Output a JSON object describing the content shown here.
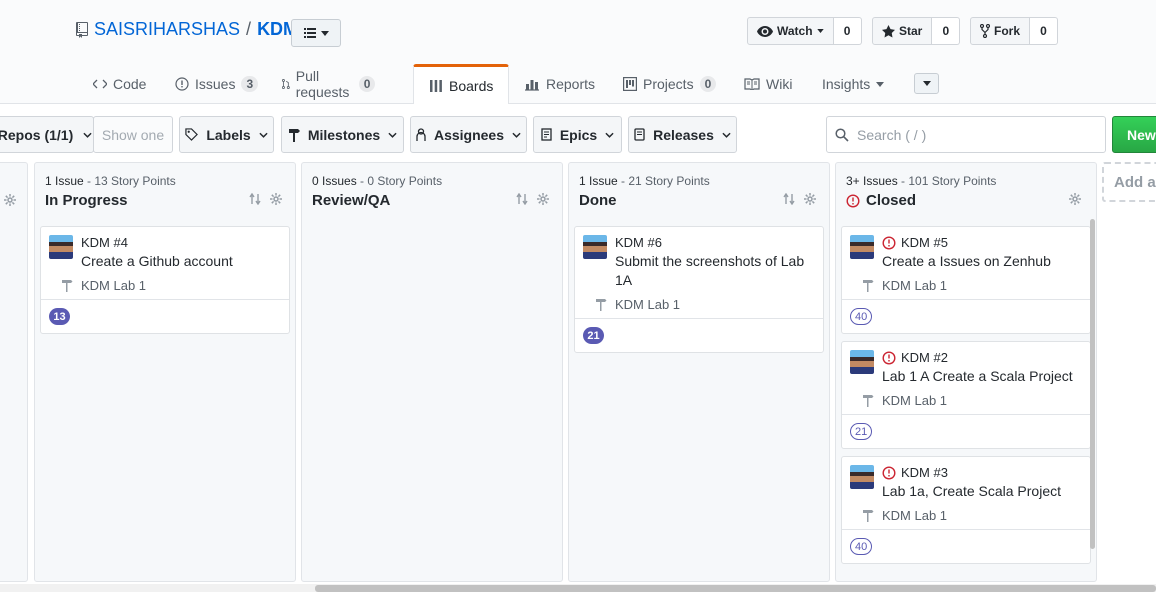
{
  "repo": {
    "owner": "SAISRIHARSHAS",
    "separator": "/",
    "name": "KDM"
  },
  "actions": {
    "watch": {
      "label": "Watch",
      "count": "0"
    },
    "star": {
      "label": "Star",
      "count": "0"
    },
    "fork": {
      "label": "Fork",
      "count": "0"
    }
  },
  "tabs": [
    {
      "label": "Code",
      "icon": "code-icon"
    },
    {
      "label": "Issues",
      "count": "3",
      "icon": "issue-icon"
    },
    {
      "label": "Pull requests",
      "count": "0",
      "icon": "pull-request-icon"
    },
    {
      "label": "Boards",
      "icon": "boards-icon",
      "selected": true
    },
    {
      "label": "Reports",
      "icon": "graph-icon"
    },
    {
      "label": "Projects",
      "count": "0",
      "icon": "project-icon"
    },
    {
      "label": "Wiki",
      "icon": "book-icon"
    },
    {
      "label": "Insights",
      "icon": "chevron-down-icon"
    }
  ],
  "filters": {
    "repos": "Repos (1/1)",
    "show_one": "Show one",
    "labels": "Labels",
    "milestones": "Milestones",
    "assignees": "Assignees",
    "epics": "Epics",
    "releases": "Releases",
    "search_placeholder": "Search ( / )",
    "new_button": "New"
  },
  "pipelines": [
    {
      "meta_issues": "1 Issue",
      "meta_points": " - 13 Story Points",
      "title": "In Progress",
      "cards": [
        {
          "ref": "KDM #4",
          "title": "Create a Github account",
          "milestone": "KDM Lab 1",
          "estimate": "13",
          "closed": false
        }
      ]
    },
    {
      "meta_issues": "0 Issues",
      "meta_points": " - 0 Story Points",
      "title": "Review/QA",
      "cards": []
    },
    {
      "meta_issues": "1 Issue",
      "meta_points": " - 21 Story Points",
      "title": "Done",
      "cards": [
        {
          "ref": "KDM #6",
          "title": "Submit the screenshots of Lab 1A",
          "milestone": "KDM Lab 1",
          "estimate": "21",
          "closed": false
        }
      ]
    },
    {
      "meta_issues": "3+ Issues",
      "meta_points": " - 101 Story Points",
      "title": "Closed",
      "cards": [
        {
          "ref": "KDM #5",
          "title": "Create a Issues on Zenhub",
          "milestone": "KDM Lab 1",
          "estimate": "40",
          "closed": true
        },
        {
          "ref": "KDM #2",
          "title": "Lab 1 A Create a Scala Project",
          "milestone": "KDM Lab 1",
          "estimate": "21",
          "closed": true
        },
        {
          "ref": "KDM #3",
          "title": "Lab 1a, Create Scala Project",
          "milestone": "KDM Lab 1",
          "estimate": "40",
          "closed": true
        }
      ]
    }
  ],
  "add_pipeline": "Add a",
  "colors": {
    "link": "#0366d6",
    "estimate": "#5a5ab3",
    "closed": "#cb2431",
    "new_button": "#28a745",
    "tab_accent": "#e36209"
  }
}
